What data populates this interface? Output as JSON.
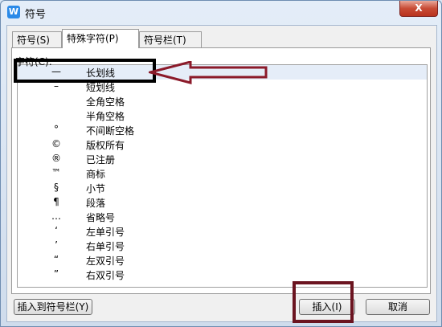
{
  "window": {
    "title": "符号",
    "app_icon_glyph": "W",
    "close_glyph": "X"
  },
  "tabs": [
    {
      "label": "符号(S)"
    },
    {
      "label": "特殊字符(P)"
    },
    {
      "label": "符号栏(T)"
    }
  ],
  "list": {
    "group_label": "字符(C):",
    "items": [
      {
        "symbol": "—",
        "name": "长划线"
      },
      {
        "symbol": "–",
        "name": "短划线"
      },
      {
        "symbol": "",
        "name": "全角空格"
      },
      {
        "symbol": "",
        "name": "半角空格"
      },
      {
        "symbol": "°",
        "name": "不间断空格"
      },
      {
        "symbol": "©",
        "name": "版权所有"
      },
      {
        "symbol": "®",
        "name": "已注册"
      },
      {
        "symbol": "™",
        "name": "商标"
      },
      {
        "symbol": "§",
        "name": "小节"
      },
      {
        "symbol": "¶",
        "name": "段落"
      },
      {
        "symbol": "…",
        "name": "省略号"
      },
      {
        "symbol": "‘",
        "name": "左单引号"
      },
      {
        "symbol": "’",
        "name": "右单引号"
      },
      {
        "symbol": "“",
        "name": "左双引号"
      },
      {
        "symbol": "”",
        "name": "右双引号"
      }
    ]
  },
  "buttons": {
    "insert_to_bar": "插入到符号栏(Y)",
    "insert": "插入(I)",
    "cancel": "取消"
  },
  "colors": {
    "annotation_box": "#000000",
    "annotation_arrow": "#8b1a2a",
    "insert_box": "#6b1420"
  }
}
